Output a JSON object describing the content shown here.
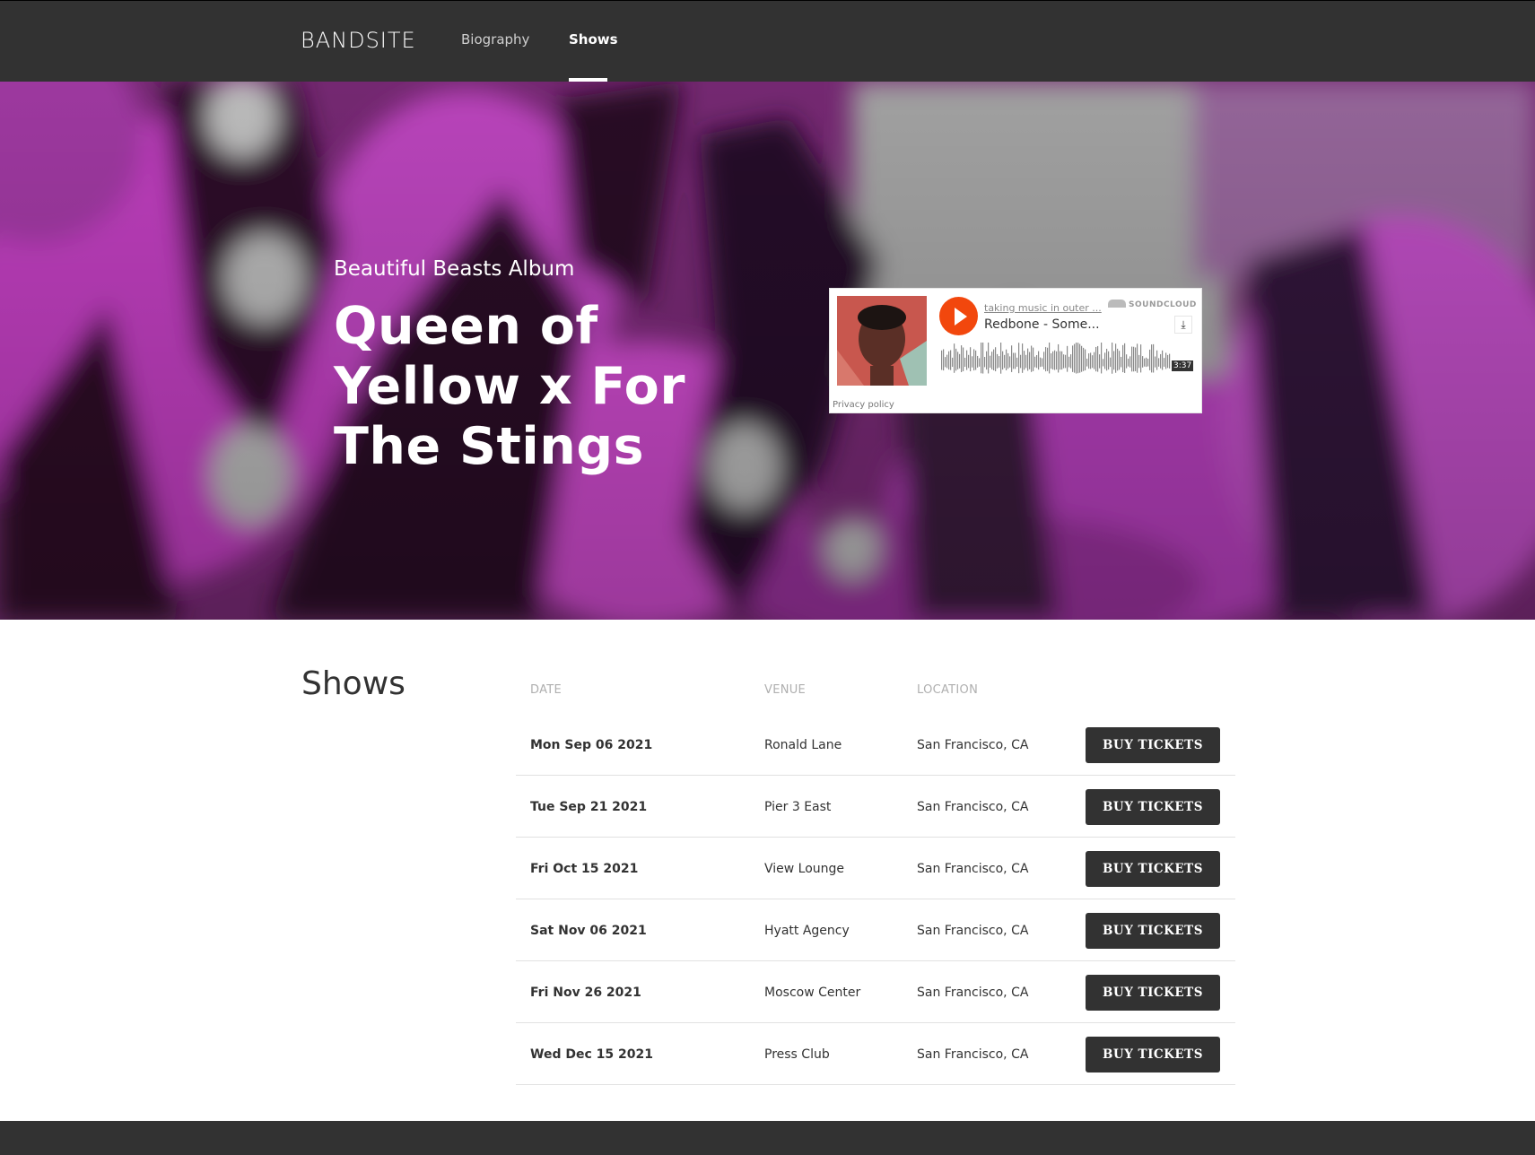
{
  "nav": {
    "brand": "BANDSITE",
    "links": [
      {
        "label": "Biography"
      },
      {
        "label": "Shows"
      }
    ]
  },
  "hero": {
    "subtitle": "Beautiful Beasts Album",
    "title": "Queen of Yellow x For The Stings"
  },
  "player": {
    "user": "taking music in outer ...",
    "track": "Redbone - Some...",
    "brand": "SOUNDCLOUD",
    "duration": "3:37",
    "privacy": "Privacy policy"
  },
  "shows": {
    "heading": "Shows",
    "columns": {
      "date": "DATE",
      "venue": "VENUE",
      "location": "LOCATION"
    },
    "rows": [
      {
        "date": "Mon Sep 06 2021",
        "venue": "Ronald Lane",
        "location": "San Francisco, CA",
        "button": "BUY TICKETS"
      },
      {
        "date": "Tue Sep 21 2021",
        "venue": "Pier 3 East",
        "location": "San Francisco, CA",
        "button": "BUY TICKETS"
      },
      {
        "date": "Fri Oct 15 2021",
        "venue": "View Lounge",
        "location": "San Francisco, CA",
        "button": "BUY TICKETS"
      },
      {
        "date": "Sat Nov 06 2021",
        "venue": "Hyatt Agency",
        "location": "San Francisco, CA",
        "button": "BUY TICKETS"
      },
      {
        "date": "Fri Nov 26 2021",
        "venue": "Moscow Center",
        "location": "San Francisco, CA",
        "button": "BUY TICKETS"
      },
      {
        "date": "Wed Dec 15 2021",
        "venue": "Press Club",
        "location": "San Francisco, CA",
        "button": "BUY TICKETS"
      }
    ]
  },
  "colors": {
    "nav_bg": "#323232",
    "button_bg": "#323232",
    "play_button": "#f2470d",
    "hero_tint": "#b03cb8"
  }
}
